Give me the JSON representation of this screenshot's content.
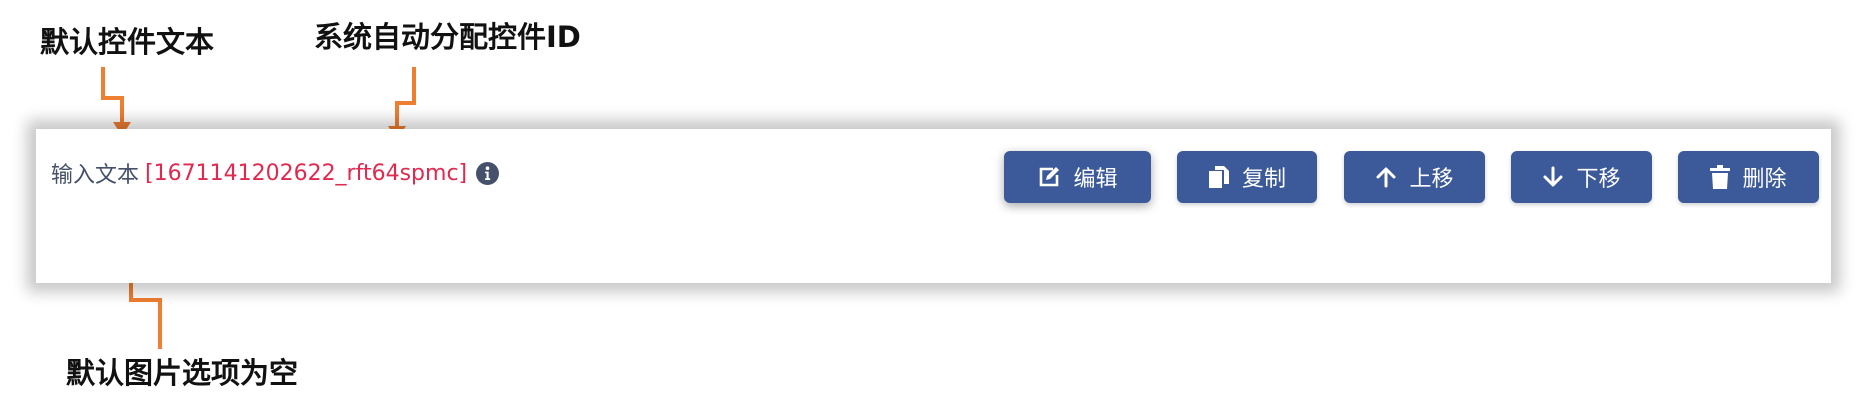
{
  "annotations": {
    "default_control_text": "默认控件文本",
    "auto_assigned_id": "系统自动分配控件ID",
    "default_image_option_empty": "默认图片选项为空"
  },
  "field": {
    "label": "输入文本",
    "control_id": "[1671141202622_rft64spmc]"
  },
  "toolbar": {
    "edit_label": "编辑",
    "copy_label": "复制",
    "move_up_label": "上移",
    "move_down_label": "下移",
    "delete_label": "删除"
  },
  "colors": {
    "button_bg": "#3c5a99",
    "id_text": "#e0294e",
    "label_text": "#45506a",
    "annotation_arrow": "#ee7e30"
  }
}
